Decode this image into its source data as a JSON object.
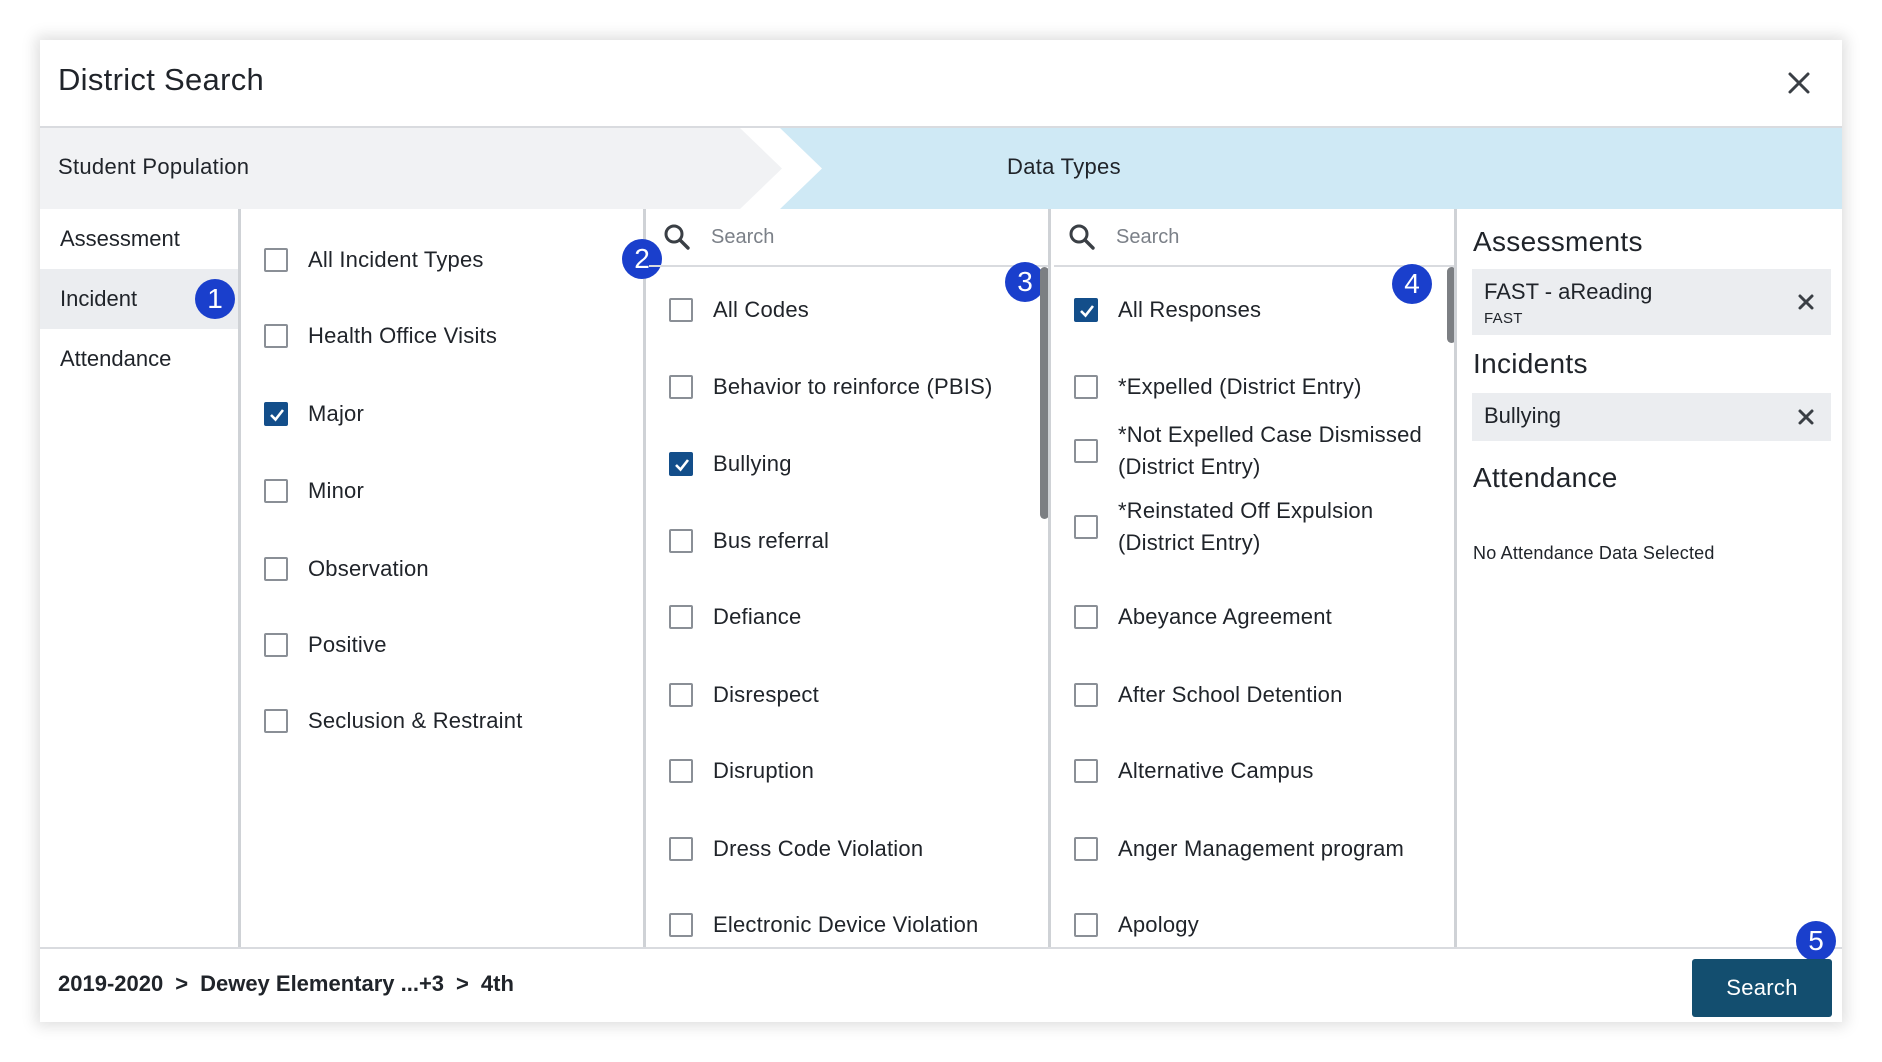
{
  "dialog": {
    "title": "District Search"
  },
  "steps": [
    {
      "label": "Student Population",
      "active": false
    },
    {
      "label": "Data Types",
      "active": true
    }
  ],
  "nav": {
    "items": [
      {
        "label": "Assessment",
        "active": false
      },
      {
        "label": "Incident",
        "active": true
      },
      {
        "label": "Attendance",
        "active": false
      }
    ]
  },
  "badges": [
    "1",
    "2",
    "3",
    "4",
    "5"
  ],
  "incident_types": [
    {
      "label": "All Incident Types",
      "checked": false
    },
    {
      "label": "Health Office Visits",
      "checked": false
    },
    {
      "label": "Major",
      "checked": true
    },
    {
      "label": "Minor",
      "checked": false
    },
    {
      "label": "Observation",
      "checked": false
    },
    {
      "label": "Positive",
      "checked": false
    },
    {
      "label": "Seclusion & Restraint",
      "checked": false
    }
  ],
  "codes": {
    "search_placeholder": "Search",
    "items": [
      {
        "label": "All Codes",
        "checked": false
      },
      {
        "label": "Behavior to reinforce (PBIS)",
        "checked": false
      },
      {
        "label": "Bullying",
        "checked": true
      },
      {
        "label": "Bus referral",
        "checked": false
      },
      {
        "label": "Defiance",
        "checked": false
      },
      {
        "label": "Disrespect",
        "checked": false
      },
      {
        "label": "Disruption",
        "checked": false
      },
      {
        "label": "Dress Code Violation",
        "checked": false
      },
      {
        "label": "Electronic Device Violation",
        "checked": false
      }
    ]
  },
  "responses": {
    "search_placeholder": "Search",
    "items": [
      {
        "label": "All Responses",
        "checked": true
      },
      {
        "label": "*Expelled (District Entry)",
        "checked": false
      },
      {
        "label": "*Not Expelled Case Dismissed (District Entry)",
        "checked": false
      },
      {
        "label": "*Reinstated Off Expulsion (District Entry)",
        "checked": false
      },
      {
        "label": "Abeyance Agreement",
        "checked": false
      },
      {
        "label": "After School Detention",
        "checked": false
      },
      {
        "label": "Alternative Campus",
        "checked": false
      },
      {
        "label": "Anger Management program",
        "checked": false
      },
      {
        "label": "Apology",
        "checked": false
      }
    ]
  },
  "summary": {
    "assessments_heading": "Assessments",
    "assessment_chip": {
      "title": "FAST - aReading",
      "sub": "FAST"
    },
    "incidents_heading": "Incidents",
    "incident_chip": {
      "title": "Bullying"
    },
    "attendance_heading": "Attendance",
    "attendance_note": "No Attendance Data Selected"
  },
  "footer": {
    "breadcrumb": [
      "2019-2020",
      ">",
      "Dewey Elementary ...+3",
      ">",
      "4th"
    ],
    "search_label": "Search"
  },
  "colors": {
    "accent": "#134e6f",
    "checked": "#134e8a",
    "badge": "#1a3fcc",
    "active_step": "#cfe9f5",
    "inactive_step": "#f1f2f4"
  }
}
